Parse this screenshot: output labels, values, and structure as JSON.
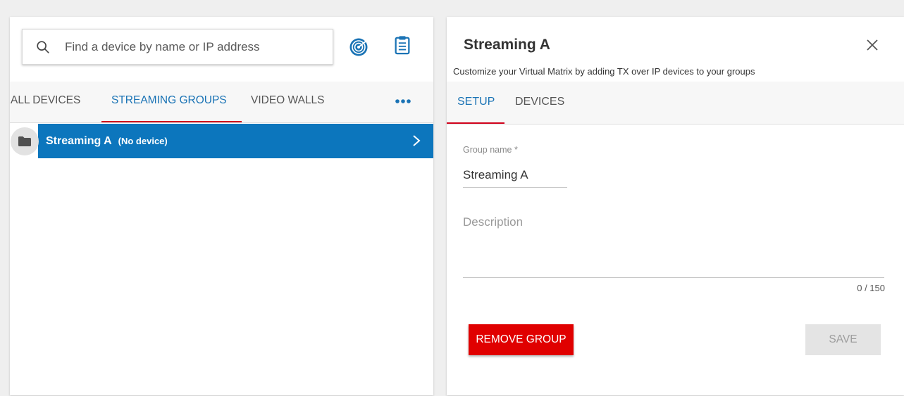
{
  "search": {
    "placeholder": "Find a device by name or IP address",
    "value": ""
  },
  "toolbar": {
    "scan_icon": "radar-icon",
    "report_icon": "clipboard-icon"
  },
  "tabs": [
    {
      "label": "ALL DEVICES",
      "active": false
    },
    {
      "label": "STREAMING GROUPS",
      "active": true
    },
    {
      "label": "VIDEO WALLS",
      "active": false
    }
  ],
  "more_icon": "more-horizontal-icon",
  "groups": [
    {
      "name": "Streaming A",
      "status": "(No device)",
      "selected": true
    }
  ],
  "detail": {
    "title": "Streaming A",
    "subtitle": "Customize your Virtual Matrix by adding TX over IP devices to your groups",
    "tabs": [
      {
        "label": "SETUP",
        "active": true
      },
      {
        "label": "DEVICES",
        "active": false
      }
    ],
    "form": {
      "group_name_label": "Group name *",
      "group_name_value": "Streaming A",
      "description_placeholder": "Description",
      "description_value": "",
      "char_counter": "0 / 150"
    },
    "buttons": {
      "remove": "REMOVE GROUP",
      "save": "SAVE"
    }
  },
  "colors": {
    "accent": "#0c76bd",
    "tab_active": "#1a73b5",
    "tab_underline": "#d0021b",
    "danger": "#e00000",
    "disabled": "#e4e4e4"
  }
}
